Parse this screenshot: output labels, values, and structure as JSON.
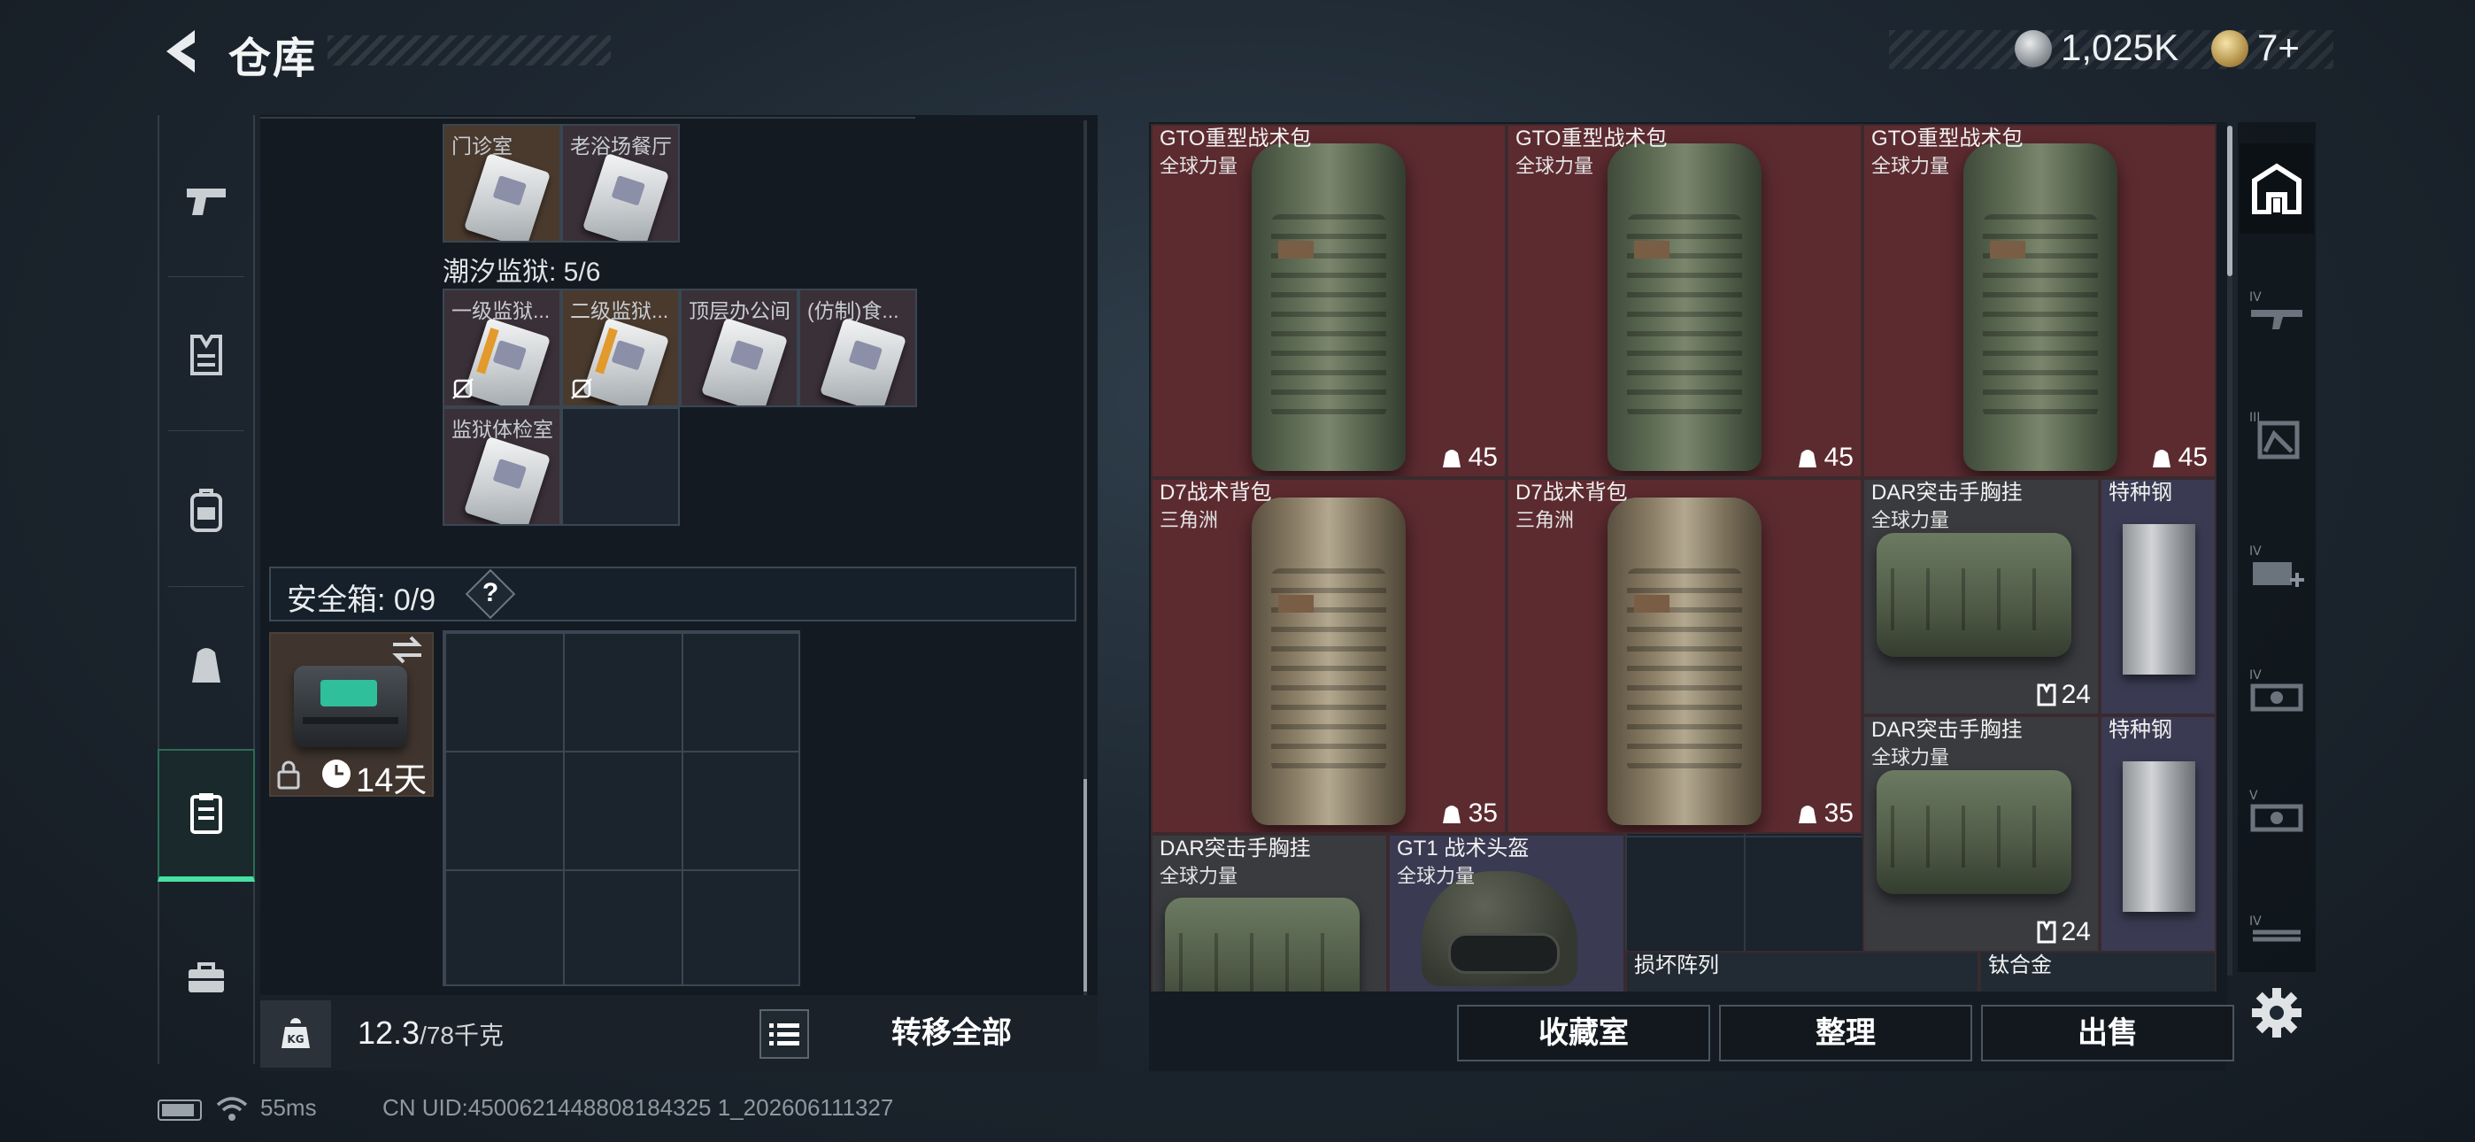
{
  "header": {
    "title": "仓库",
    "currency_silver": "1,025K",
    "currency_gold": "7+"
  },
  "rail": {
    "items": [
      {
        "icon": "pistol-icon"
      },
      {
        "icon": "armor-vest-icon"
      },
      {
        "icon": "backpack-icon"
      },
      {
        "icon": "chest-rig-icon"
      },
      {
        "icon": "safebox-icon",
        "active": true
      },
      {
        "icon": "toolbox-icon"
      }
    ]
  },
  "keys": {
    "row1": [
      {
        "label": "门诊室"
      },
      {
        "label": "老浴场餐厅"
      }
    ],
    "section2_title": "潮汐监狱: 5/6",
    "row2": [
      {
        "label": "一级监狱..."
      },
      {
        "label": "二级监狱..."
      },
      {
        "label": "顶层办公间"
      },
      {
        "label": "(仿制)食..."
      }
    ],
    "row3": [
      {
        "label": "监狱体检室"
      }
    ]
  },
  "safebox": {
    "label": "安全箱: 0/9",
    "help": "?",
    "duration": "14天"
  },
  "weight": {
    "current": "12.3",
    "max": "/78千克",
    "transfer_all": "转移全部"
  },
  "stash": {
    "items": [
      {
        "name": "GTO重型战术包",
        "sub": "全球力量",
        "value": "45"
      },
      {
        "name": "GTO重型战术包",
        "sub": "全球力量",
        "value": "45"
      },
      {
        "name": "GTO重型战术包",
        "sub": "全球力量",
        "value": "45"
      },
      {
        "name": "D7战术背包",
        "sub": "三角洲",
        "value": "35"
      },
      {
        "name": "D7战术背包",
        "sub": "三角洲",
        "value": "35"
      },
      {
        "name": "DAR突击手胸挂",
        "sub": "全球力量",
        "value": "24"
      },
      {
        "name": "特种钢",
        "sub": ""
      },
      {
        "name": "DAR突击手胸挂",
        "sub": "全球力量",
        "value": "24"
      },
      {
        "name": "特种钢",
        "sub": ""
      },
      {
        "name": "DAR突击手胸挂",
        "sub": "全球力量"
      },
      {
        "name": "GT1 战术头盔",
        "sub": "全球力量"
      },
      {
        "name": "损坏阵列",
        "sub": ""
      },
      {
        "name": "钛合金",
        "sub": ""
      }
    ]
  },
  "right_tabs": [
    {
      "icon": "stash-home-icon",
      "active": true
    },
    {
      "icon": "rifle-tier-iv-icon"
    },
    {
      "icon": "armor-tier-iii-icon"
    },
    {
      "icon": "medkit-tier-iv-icon"
    },
    {
      "icon": "ammo-tier-iv-icon"
    },
    {
      "icon": "optic-tier-v-icon"
    },
    {
      "icon": "tier-iv-icon"
    }
  ],
  "bottom_actions": {
    "collection": "收藏室",
    "organize": "整理",
    "sell": "出售"
  },
  "status": {
    "ping": "55ms",
    "uid": "CN UID:4500621448808184325 1_202606111327"
  }
}
